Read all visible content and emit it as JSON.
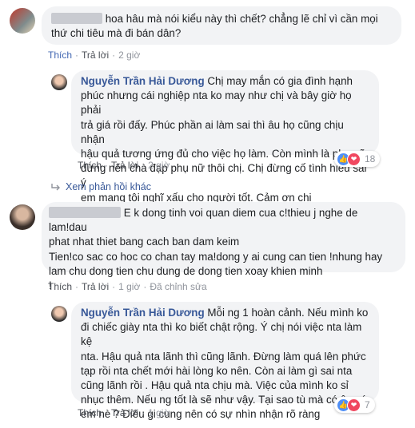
{
  "comments": [
    {
      "text": "hoa hâu mà nói kiểu này thì chết? chẳng lẽ chỉ vì cần mọi thứ chi tiêu mà đi bán dân?",
      "actions": {
        "like": "Thích",
        "reply": "Trả lời",
        "sep": "·",
        "time": "2 giờ"
      }
    },
    {
      "name": "Nguyễn Trần Hải Dương",
      "text": "Chị may mắn có gia đình hạnh\nphúc nhưng cái nghiệp nta ko may như chị và bây giờ họ phải\ntrả giá rồi đấy. Phúc phần ai làm sai thì âu họ cũng chịu nhận\nhậu quả tương ứng đủ cho việc họ làm. Còn mình là phụ nữ\nđừng nên chà đạp phụ nữ thôi chị. Chị đừng cố tình hiểu sai ý\nem mang tội nghĩ xấu cho người tốt. Cảm ơn chị",
      "actions": {
        "like": "Thích",
        "reply": "Trả lời",
        "sep": "·",
        "time": "2 giờ"
      },
      "reactions": {
        "count": "18"
      }
    },
    {
      "view_more": "Xem phản hồi khác"
    },
    {
      "text": "E k dong tinh voi quan diem cua c!thieu j nghe de lam!dau\nphat nhat thiet bang cach ban dam keim\nTien!co sac co hoc co chan tay ma!dong y ai cung can tien !nhung hay\nlam chu dong tien chu dung de dong tien xoay khien minh\n!",
      "actions": {
        "like": "Thích",
        "reply": "Trả lời",
        "sep": "·",
        "time": "1 giờ",
        "edited": "Đã chỉnh sửa"
      }
    },
    {
      "name": "Nguyễn Trần Hải Dương",
      "text": "Mỗi ng 1 hoàn cảnh. Nếu mình ko\nđi chiếc giày nta thì ko biết chật rộng. Ý chị nói việc nta làm kệ\nnta. Hậu quả nta lãnh thì cũng lãnh. Đừng làm quá lên phức\ntạp rồi nta chết mới hài lòng ko nên. Còn ai làm gì sai nta\ncũng lãnh rồi . Hậu quả nta chịu mà. Việc của mình ko sỉ\nnhục thêm. Nếu ng tốt là sẽ như vậy. Tại sao tù mà có ân xá\nem nè ? Điêu gi cung nên có sự nhìn nhận rõ ràng",
      "actions": {
        "like": "Thích",
        "reply": "Trả lời",
        "sep": "·",
        "time": "1 giờ"
      },
      "reactions": {
        "count": "7"
      }
    }
  ],
  "colors": {
    "name": "#385898",
    "liked": "#4267b2",
    "bubble": "#f2f3f5",
    "like_icon": "#4f8ff7",
    "love_icon": "#f0475f"
  },
  "icons": {
    "reply_arrow": "reply-arrow-icon",
    "like": "like-reaction-icon",
    "love": "love-reaction-icon"
  }
}
